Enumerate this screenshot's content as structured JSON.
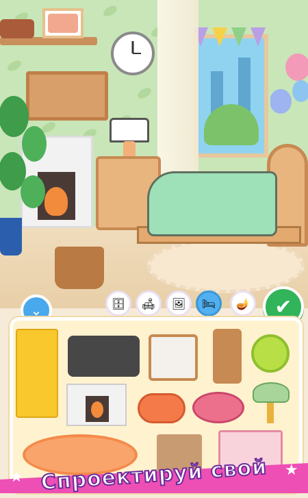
{
  "banner": {
    "text": "Спроектируй свой"
  },
  "toolbar": {
    "collapse_icon": "chevron-down-icon",
    "confirm_icon": "check-icon",
    "categories": [
      {
        "name": "desk-category",
        "active": false
      },
      {
        "name": "sofa-category",
        "active": false
      },
      {
        "name": "wall-decor-category",
        "active": false
      },
      {
        "name": "bed-category",
        "active": true
      },
      {
        "name": "misc-category",
        "active": false
      }
    ]
  },
  "inventory": {
    "items": [
      "yellow-fridge",
      "dark-sofa",
      "wicker-armchair",
      "wooden-chair",
      "lime-pillow",
      "white-fireplace",
      "orange-slice-cushion",
      "pink-pouf",
      "green-table-lamp",
      "orange-slice-rug",
      "wicker-basket",
      "pink-shelf"
    ]
  },
  "colors": {
    "accent_blue": "#52b0f0",
    "confirm_green": "#31b45a",
    "panel_bg": "#fff2cf",
    "banner_pink": "#ee4fb4"
  }
}
